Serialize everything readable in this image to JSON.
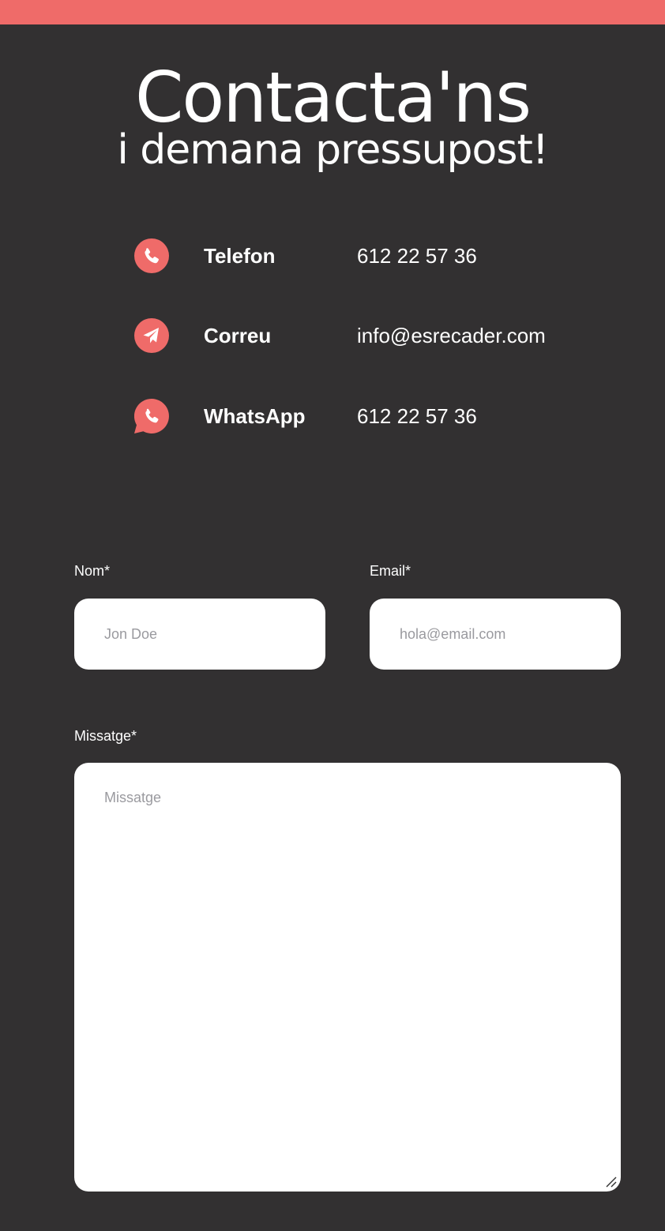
{
  "header": {
    "title": "Contacta'ns",
    "subtitle": "i demana pressupost!"
  },
  "contacts": [
    {
      "icon": "phone-icon",
      "label": "Telefon",
      "value": "612 22 57 36"
    },
    {
      "icon": "paper-plane-icon",
      "label": "Correu",
      "value": "info@esrecader.com"
    },
    {
      "icon": "whatsapp-icon",
      "label": "WhatsApp",
      "value": "612 22 57 36"
    }
  ],
  "form": {
    "name_label": "Nom*",
    "name_placeholder": "Jon Doe",
    "email_label": "Email*",
    "email_placeholder": "hola@email.com",
    "message_label": "Missatge*",
    "message_placeholder": "Missatge"
  },
  "colors": {
    "accent": "#ef6b69",
    "background": "#323031",
    "field_background": "#ffffff"
  }
}
